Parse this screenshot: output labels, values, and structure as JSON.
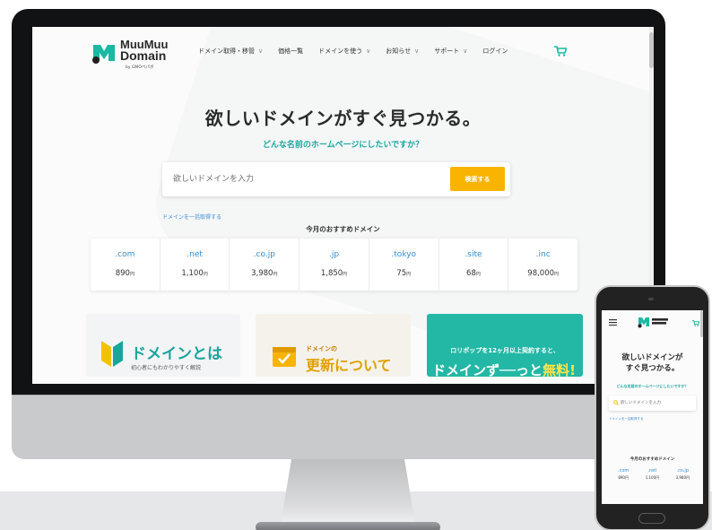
{
  "site": {
    "logo_line1": "MuuMuu",
    "logo_line2": "Domain",
    "logo_sub": "by GMOペパボ"
  },
  "nav": {
    "items": [
      {
        "label": "ドメイン取得・移管",
        "dropdown": true
      },
      {
        "label": "価格一覧",
        "dropdown": false
      },
      {
        "label": "ドメインを使う",
        "dropdown": true
      },
      {
        "label": "お知らせ",
        "dropdown": true
      },
      {
        "label": "サポート",
        "dropdown": true
      },
      {
        "label": "ログイン",
        "dropdown": false
      }
    ],
    "cart_icon": "cart-icon"
  },
  "hero": {
    "title": "欲しいドメインがすぐ見つかる。",
    "subtitle": "どんな名前のホームページにしたいですか？"
  },
  "search": {
    "placeholder": "欲しいドメインを入力",
    "button_label": "検索する",
    "bulk_link": "ドメインを一括取得する"
  },
  "recommended": {
    "title": "今月のおすすめドメイン",
    "currency": "円",
    "tlds": [
      {
        "name": ".com",
        "price": "890"
      },
      {
        "name": ".net",
        "price": "1,100"
      },
      {
        "name": ".co.jp",
        "price": "3,980"
      },
      {
        "name": ".jp",
        "price": "1,850"
      },
      {
        "name": ".tokyo",
        "price": "75"
      },
      {
        "name": ".site",
        "price": "68"
      },
      {
        "name": ".inc",
        "price": "98,000"
      }
    ]
  },
  "banners": {
    "b1_title": "ドメインとは",
    "b1_sub": "初心者にもわかりやすく解説",
    "b2_small": "ドメインの",
    "b2_big": "更新について",
    "b3_small": "ロリポップを12ヶ月以上契約すると、",
    "b3_big_main": "ドメインず──っと",
    "b3_big_accent": "無料!"
  },
  "mobile": {
    "title_line1": "欲しいドメインが",
    "title_line2": "すぐ見つかる。",
    "subtitle": "どんな名前のホームページにしたいですか？",
    "placeholder": "欲しいドメインを入力",
    "bulk_link": "ドメインを一括取得する",
    "rec_title": "今月のおすすめドメイン",
    "tlds": [
      {
        "name": ".com",
        "price": "890円"
      },
      {
        "name": ".net",
        "price": "1,100円"
      },
      {
        "name": ".co.jp",
        "price": "3,980円"
      }
    ]
  },
  "colors": {
    "accent_teal": "#1aa8a0",
    "search_button": "#f8b400",
    "link_blue": "#2f8fd4"
  }
}
